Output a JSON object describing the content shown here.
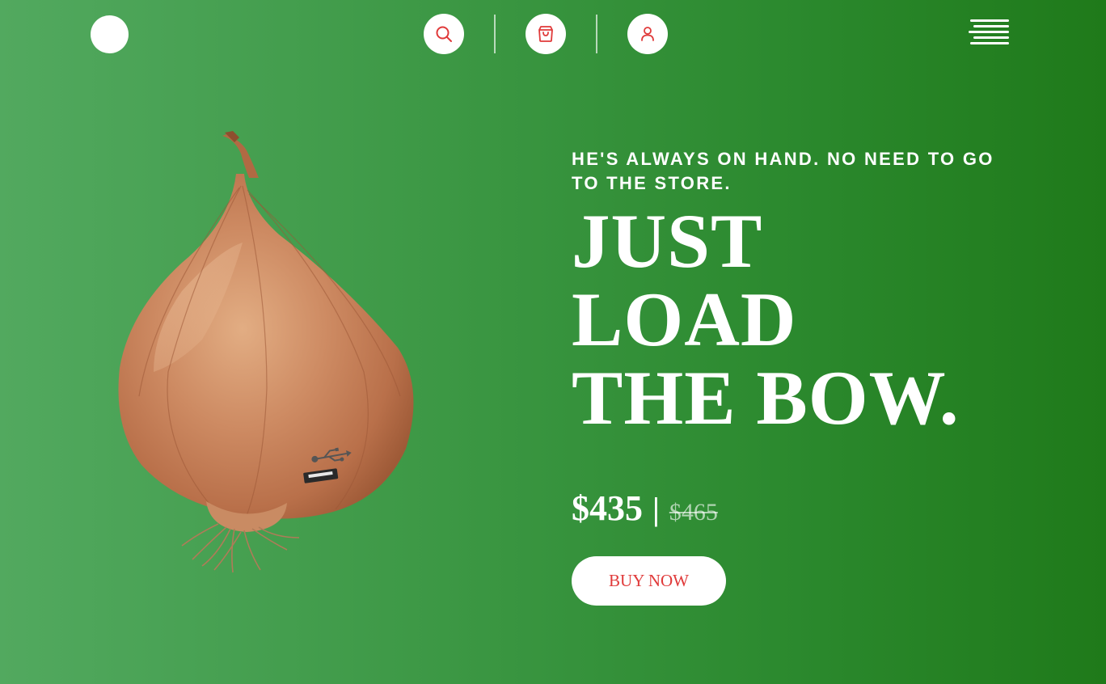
{
  "colors": {
    "accent": "#e03a3a",
    "background_start": "#52a95f",
    "background_end": "#1f7a1a",
    "white": "#ffffff"
  },
  "header": {
    "logo_icon": "logo-circle",
    "nav_icons": [
      "search-icon",
      "shopping-bag-icon",
      "user-icon"
    ],
    "menu_icon": "hamburger-menu-icon"
  },
  "hero": {
    "image_subject": "onion-with-usb-port",
    "tagline": "HE'S ALWAYS ON HAND. NO NEED TO GO TO THE STORE.",
    "headline_line1": "JUST",
    "headline_line2": "LOAD",
    "headline_line3": "THE BOW.",
    "price_current": "$435",
    "price_separator": "|",
    "price_old": "$465",
    "cta_label": "BUY NOW"
  }
}
